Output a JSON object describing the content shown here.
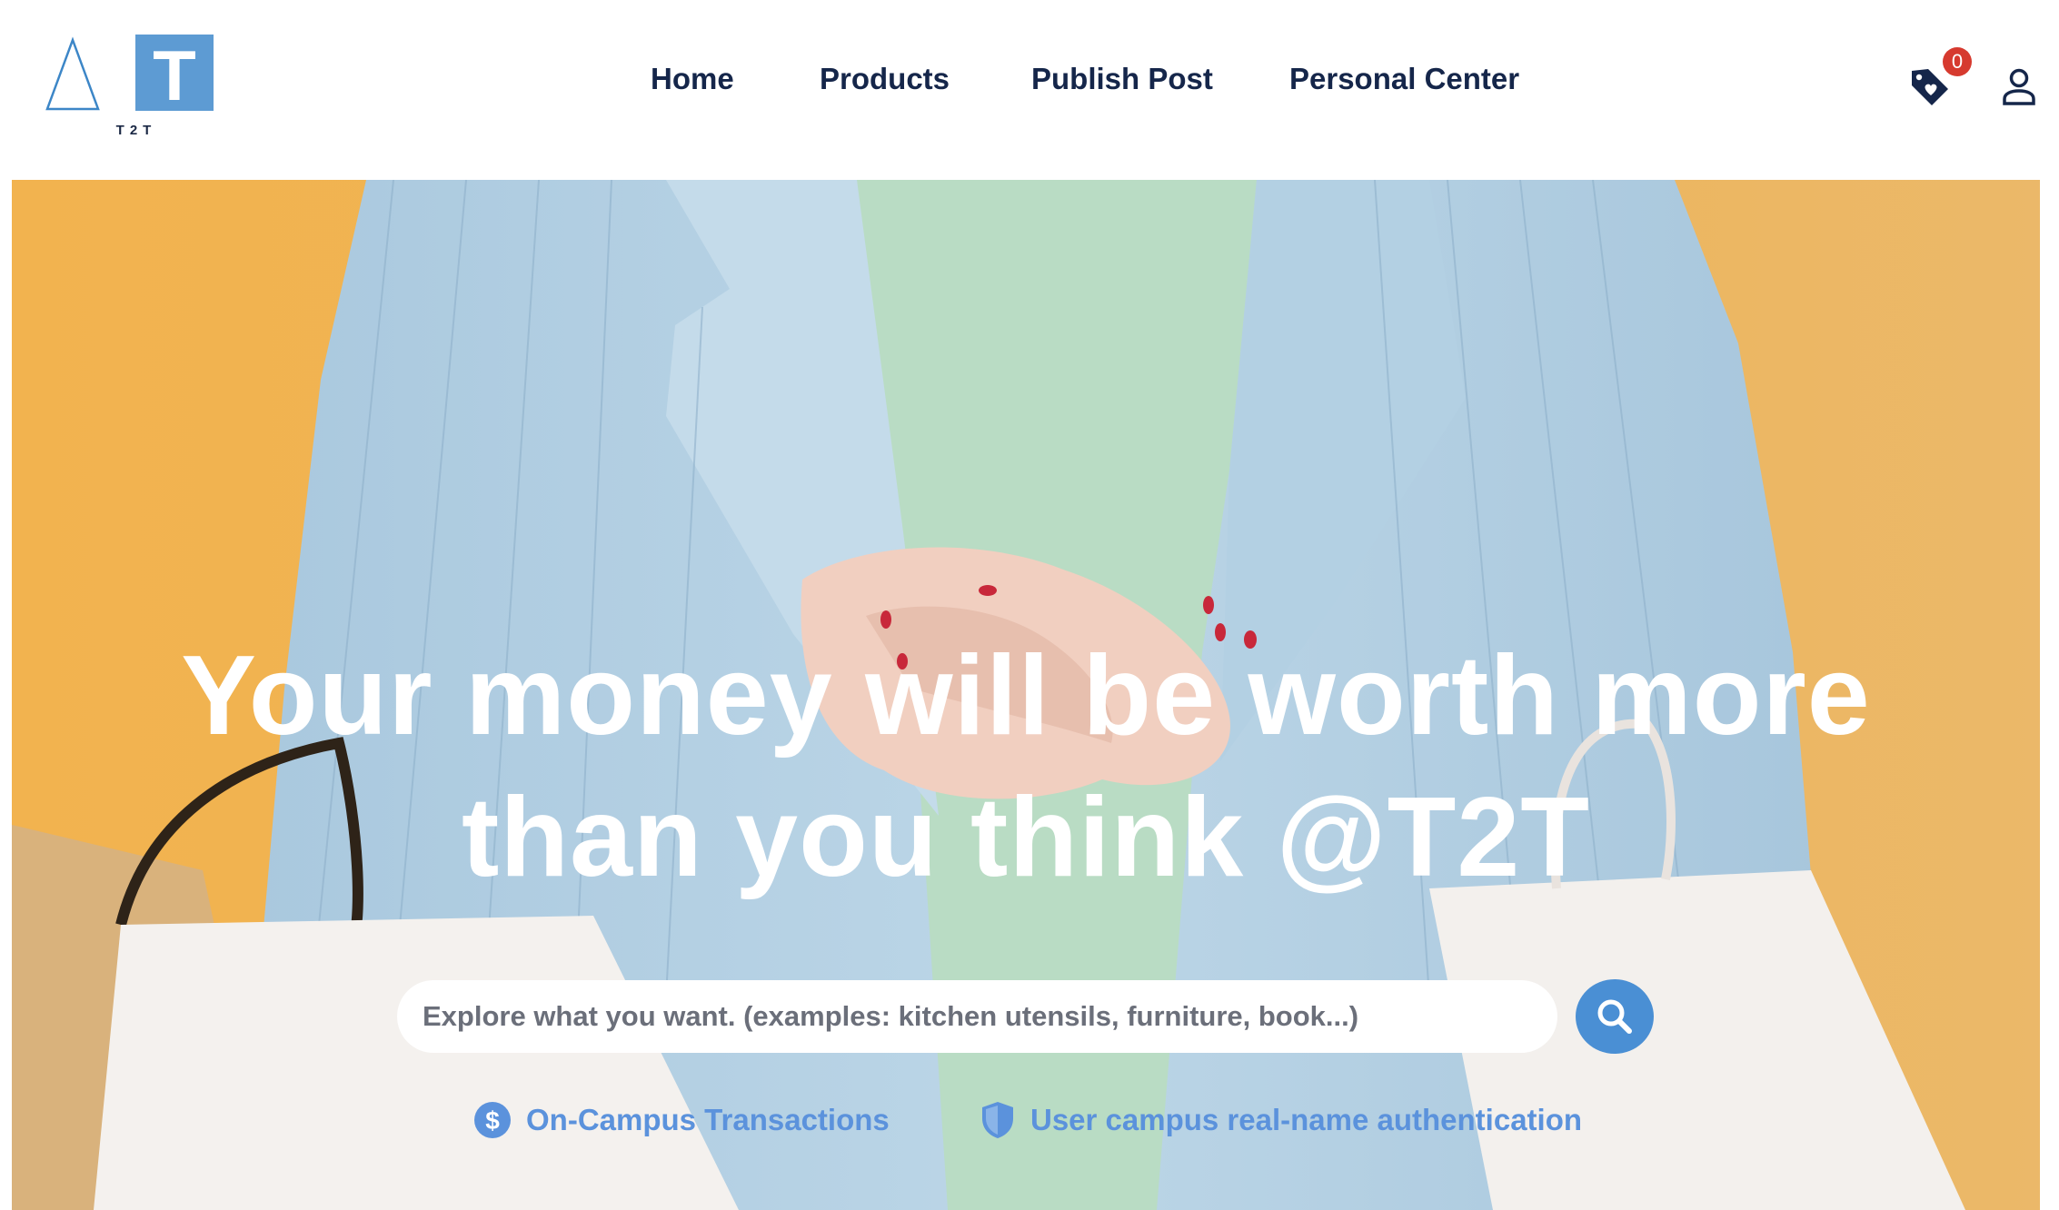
{
  "header": {
    "logo_text": "T2T",
    "logo_letter": "T",
    "nav": [
      {
        "label": "Home"
      },
      {
        "label": "Products"
      },
      {
        "label": "Publish Post"
      },
      {
        "label": "Personal Center"
      }
    ],
    "cart_count": "0",
    "icons": {
      "cart": "price-tag-icon",
      "user": "user-icon"
    }
  },
  "hero": {
    "headline_line1": "Your money will be worth more",
    "headline_line2": "than you think @T2T",
    "search": {
      "placeholder": "Explore what you want. (examples: kitchen utensils, furniture, book...)",
      "value": ""
    },
    "features": [
      {
        "label": "On-Campus Transactions",
        "icon": "dollar-coin-icon"
      },
      {
        "label": "User campus real-name authentication",
        "icon": "shield-icon"
      }
    ]
  },
  "colors": {
    "nav_text": "#15264a",
    "accent_blue": "#4a8fd4",
    "feature_blue": "#5b92dc",
    "badge_red": "#d63a2f",
    "hero_background": "#f0b452"
  }
}
